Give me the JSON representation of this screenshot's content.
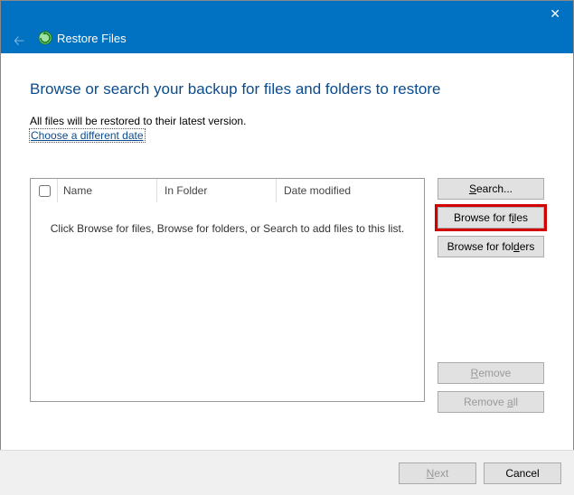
{
  "titlebar": {
    "title": "Restore Files"
  },
  "page": {
    "heading": "Browse or search your backup for files and folders to restore",
    "subline": "All files will be restored to their latest version.",
    "link": "Choose a different date"
  },
  "list": {
    "columns": {
      "name": "Name",
      "folder": "In Folder",
      "modified": "Date modified"
    },
    "empty_hint": "Click Browse for files, Browse for folders, or Search to add files to this list."
  },
  "side": {
    "search": "Search...",
    "browse_files": "Browse for files",
    "browse_folders": "Browse for folders",
    "remove": "Remove",
    "remove_all": "Remove all"
  },
  "footer": {
    "next": "Next",
    "cancel": "Cancel"
  }
}
